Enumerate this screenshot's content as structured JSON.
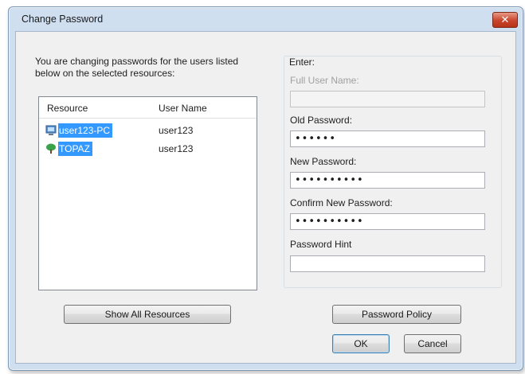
{
  "window": {
    "title": "Change Password"
  },
  "intro": {
    "text": "You are changing passwords for the users listed below on the selected resources:"
  },
  "list": {
    "columns": [
      "Resource",
      "User Name"
    ],
    "rows": [
      {
        "resource": "user123-PC",
        "user": "user123",
        "icon": "computer-icon"
      },
      {
        "resource": "TOPAZ",
        "user": "user123",
        "icon": "tree-icon"
      }
    ]
  },
  "form": {
    "group_label": "Enter:",
    "full_user_name": {
      "label": "Full User Name:",
      "value": ""
    },
    "old_password": {
      "label": "Old Password:",
      "value": "••••••"
    },
    "new_password": {
      "label": "New Password:",
      "value": "••••••••••"
    },
    "confirm_password": {
      "label": "Confirm New Password:",
      "value": "••••••••••"
    },
    "password_hint": {
      "label": "Password Hint",
      "value": ""
    }
  },
  "buttons": {
    "show_all_resources": "Show All Resources",
    "password_policy": "Password Policy",
    "ok": "OK",
    "cancel": "Cancel"
  },
  "colors": {
    "selection": "#3399ff",
    "dialog_background": "#f0f0f0",
    "frame": "#cfdff0",
    "close_button": "#c9442c"
  }
}
